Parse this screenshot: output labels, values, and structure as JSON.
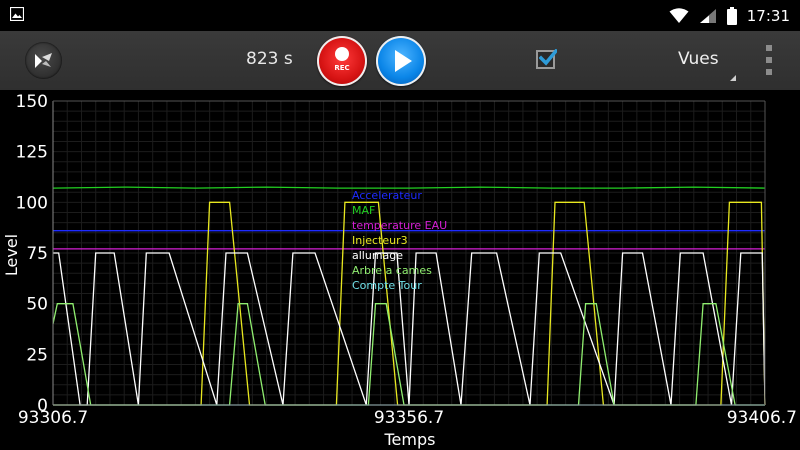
{
  "status_bar": {
    "time": "17:31"
  },
  "toolbar": {
    "timer": "823 s",
    "rec_label": "REC",
    "checkbox_checked": true,
    "views_label": "Vues"
  },
  "colors": {
    "toolbar_bg": "#333333",
    "rec_red": "#d71414",
    "play_blue": "#0b86e8",
    "checkbox_blue": "#2e9bd8"
  },
  "chart_data": {
    "type": "line",
    "xlabel": "Temps",
    "ylabel": "Level",
    "xlim": [
      93306.7,
      93406.7
    ],
    "ylim": [
      0,
      150
    ],
    "x_ticks": [
      "93306.7",
      "93356.7",
      "93406.7"
    ],
    "y_ticks": [
      "0",
      "25",
      "50",
      "75",
      "100",
      "125",
      "150"
    ],
    "grid": true,
    "legend_position": "center",
    "series": [
      {
        "name": "Accelerateur",
        "color": "#1e2bff",
        "x": [
          93306.7,
          93406.7
        ],
        "y": [
          86,
          86
        ]
      },
      {
        "name": "MAF",
        "color": "#22d022",
        "x": [
          93306.7,
          93316.7,
          93326.7,
          93336.7,
          93346.7,
          93356.7,
          93366.7,
          93376.7,
          93386.7,
          93396.7,
          93406.7
        ],
        "y": [
          107,
          107.5,
          107,
          107.5,
          107,
          107,
          107.5,
          107,
          107,
          107.5,
          107
        ]
      },
      {
        "name": "temperature EAU",
        "color": "#d61fd6",
        "x": [
          93306.7,
          93406.7
        ],
        "y": [
          77,
          77
        ]
      },
      {
        "name": "Injecteur3",
        "color": "#e8e820",
        "x": [
          93306.7,
          93327.5,
          93328.7,
          93331.5,
          93334.3,
          93346.5,
          93347.7,
          93352.4,
          93355.1,
          93376.1,
          93377.2,
          93381.3,
          93384.0,
          93400.5,
          93401.7,
          93406.2,
          93406.7
        ],
        "y": [
          0,
          0,
          100,
          100,
          0,
          0,
          100,
          100,
          0,
          0,
          100,
          100,
          0,
          0,
          100,
          100,
          0
        ]
      },
      {
        "name": "allumage",
        "color": "#ffffff",
        "x": [
          93306.7,
          93307.5,
          93310.5,
          93311.5,
          93312.7,
          93315.3,
          93318.7,
          93319.8,
          93323.0,
          93329.7,
          93331.0,
          93334.0,
          93339.0,
          93340.4,
          93343.5,
          93350.7,
          93352.0,
          93355.0,
          93356.7,
          93357.7,
          93360.5,
          93364.0,
          93365.5,
          93369.0,
          93373.7,
          93375.0,
          93378.0,
          93385.5,
          93386.7,
          93389.5,
          93393.5,
          93394.8,
          93398.0,
          93402.0,
          93403.3,
          93406.3,
          93406.7
        ],
        "y": [
          75,
          75,
          0,
          0,
          75,
          75,
          0,
          75,
          75,
          0,
          75,
          75,
          0,
          75,
          75,
          0,
          75,
          75,
          0,
          75,
          75,
          0,
          75,
          75,
          0,
          75,
          75,
          0,
          75,
          75,
          0,
          75,
          75,
          0,
          75,
          75,
          0
        ]
      },
      {
        "name": "Arbre a cames",
        "color": "#90ee70",
        "x": [
          93306.7,
          93307.3,
          93309.5,
          93310.5,
          93312.0,
          93314.5,
          93331.5,
          93332.7,
          93334.0,
          93336.5,
          93351.0,
          93352.0,
          93353.5,
          93356.0,
          93380.5,
          93381.5,
          93383.0,
          93385.5,
          93397.0,
          93398.0,
          93399.8,
          93402.5,
          93406.7
        ],
        "y": [
          40,
          50,
          50,
          30,
          0,
          0,
          0,
          50,
          50,
          0,
          0,
          50,
          50,
          0,
          0,
          50,
          50,
          0,
          0,
          50,
          50,
          0,
          0
        ]
      },
      {
        "name": "Compte Tour",
        "color": "#70e0e8",
        "x": [
          93306.7,
          93406.7
        ],
        "y": [
          0,
          0
        ]
      }
    ]
  }
}
